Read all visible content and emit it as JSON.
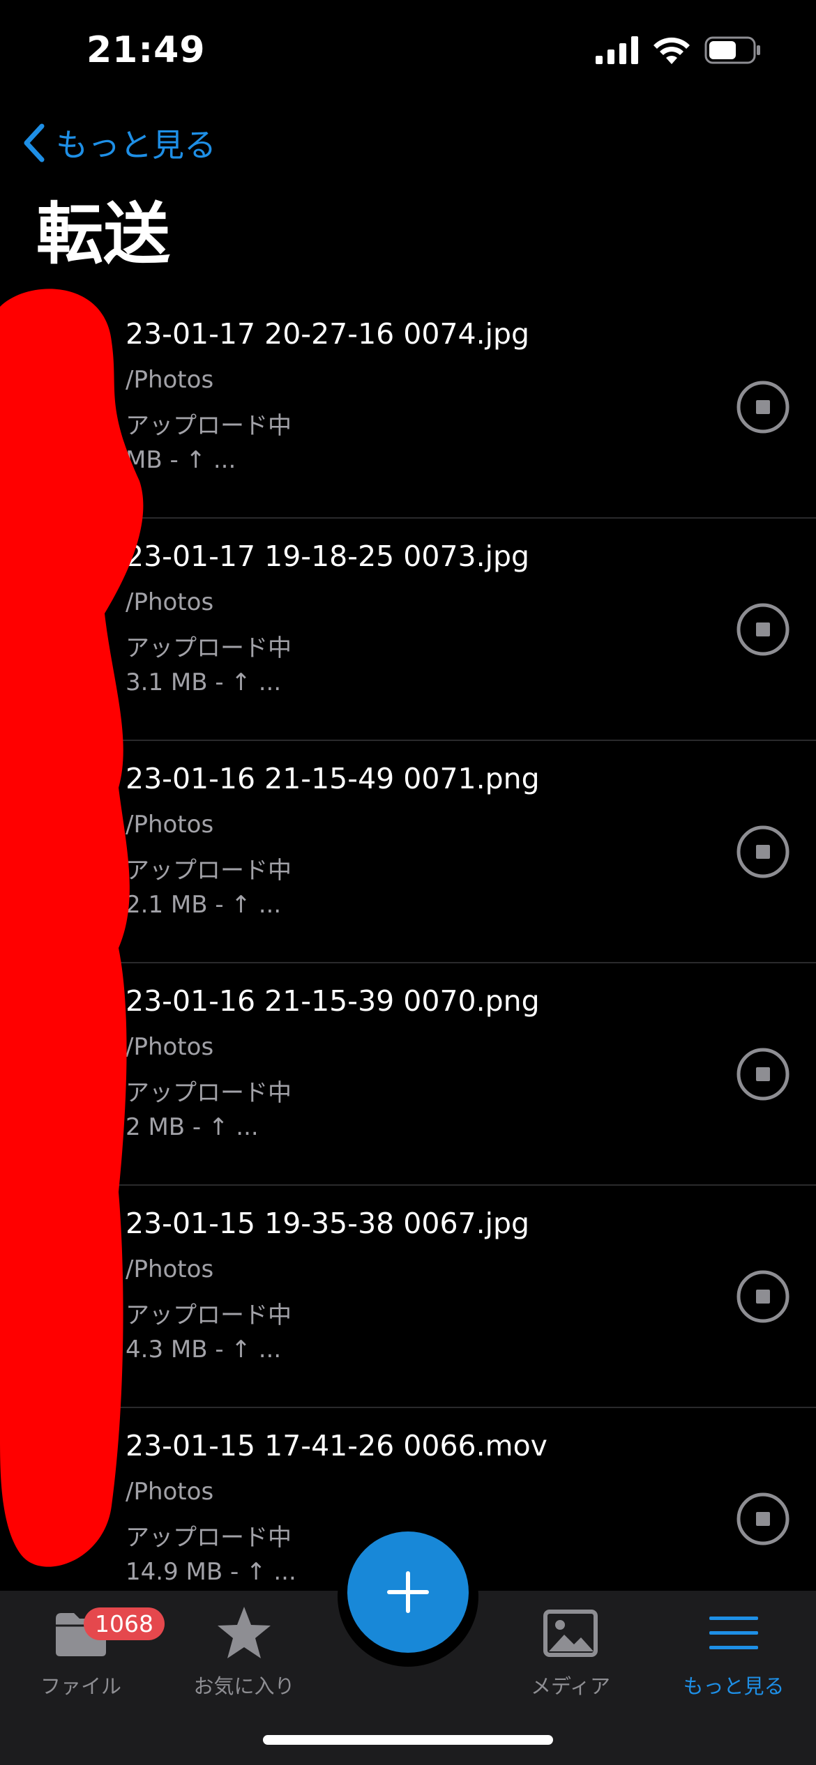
{
  "status_bar": {
    "time": "21:49"
  },
  "nav": {
    "back_label": "もっと見る",
    "title": "転送"
  },
  "transfers": [
    {
      "name": "23-01-17 20-27-16 0074.jpg",
      "path": "/Photos",
      "state": "アップロード中",
      "progress": "MB - ↑ ..."
    },
    {
      "name": "23-01-17 19-18-25 0073.jpg",
      "path": "/Photos",
      "state": "アップロード中",
      "progress": "3.1 MB - ↑ ..."
    },
    {
      "name": "23-01-16 21-15-49 0071.png",
      "path": "/Photos",
      "state": "アップロード中",
      "progress": "2.1 MB - ↑ ..."
    },
    {
      "name": "23-01-16 21-15-39 0070.png",
      "path": "/Photos",
      "state": "アップロード中",
      "progress": "2 MB - ↑ ..."
    },
    {
      "name": "23-01-15 19-35-38 0067.jpg",
      "path": "/Photos",
      "state": "アップロード中",
      "progress": "4.3 MB - ↑ ..."
    },
    {
      "name": "23-01-15 17-41-26 0066.mov",
      "path": "/Photos",
      "state": "アップロード中",
      "progress": "14.9 MB - ↑ ..."
    }
  ],
  "tab_bar": {
    "files": {
      "label": "ファイル",
      "badge": "1068",
      "icon": "folder-icon"
    },
    "favorites": {
      "label": "お気に入り",
      "icon": "star-icon"
    },
    "add": {
      "icon": "plus-icon"
    },
    "media": {
      "label": "メディア",
      "icon": "photo-icon"
    },
    "more": {
      "label": "もっと見る",
      "icon": "hamburger-icon",
      "active": true
    }
  },
  "colors": {
    "accent": "#1e8fe6",
    "fab": "#1888d8",
    "badge": "#e5484d",
    "redaction": "#ff0000"
  }
}
